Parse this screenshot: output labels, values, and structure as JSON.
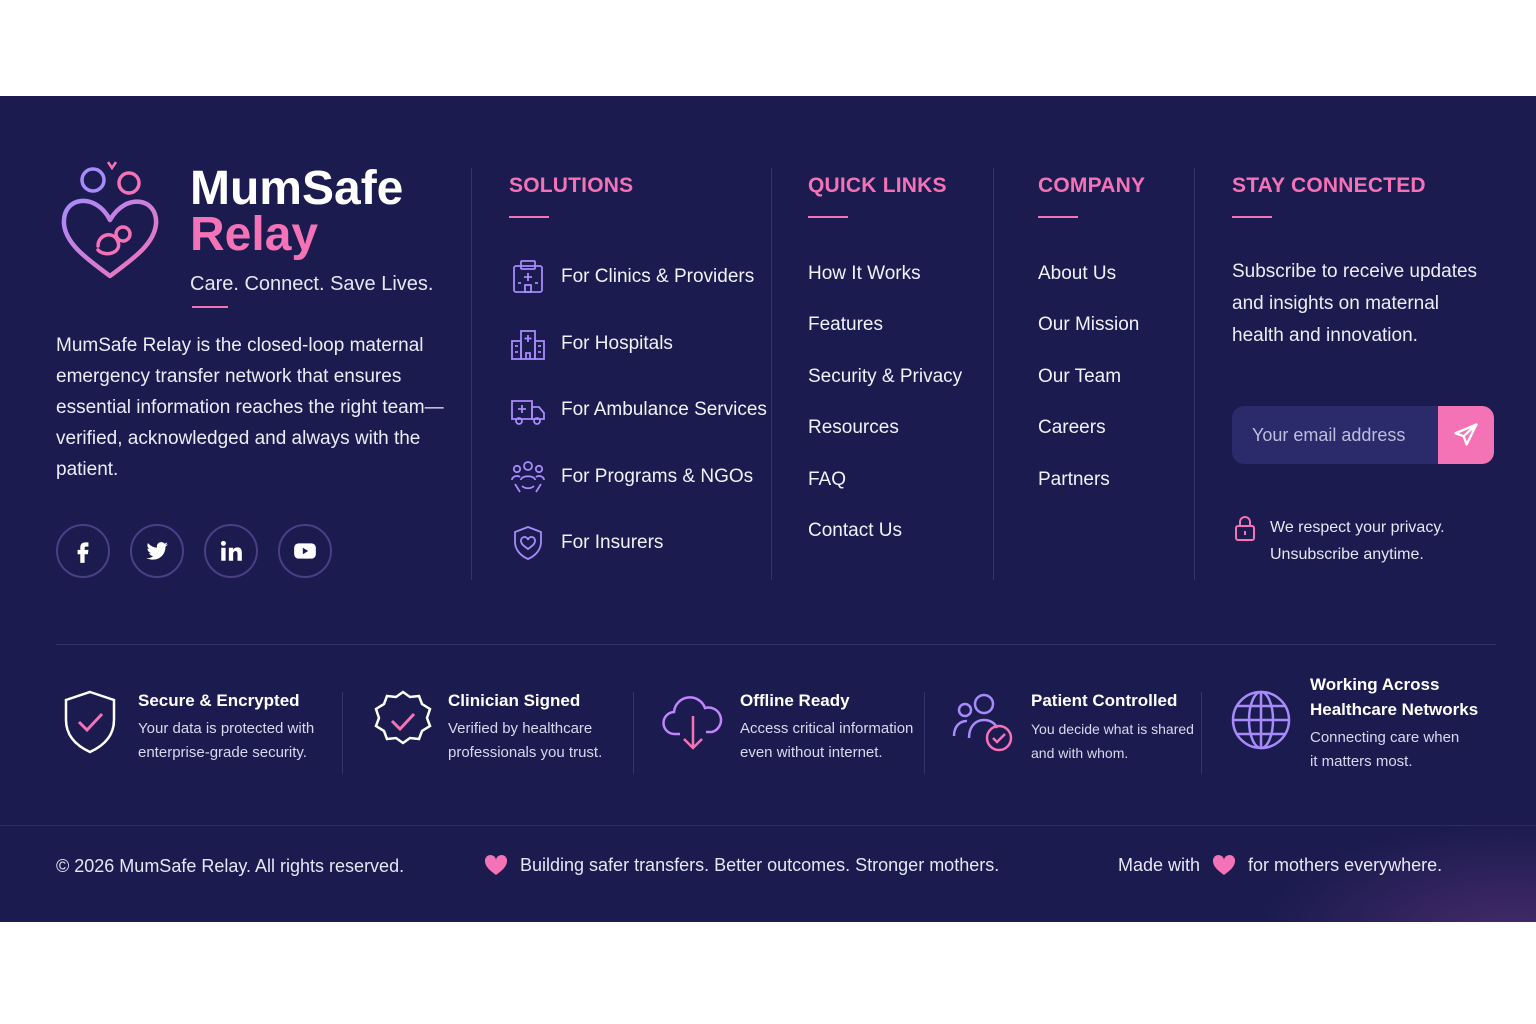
{
  "brand": {
    "name_line1": "MumSafe",
    "name_line2": "Relay",
    "tagline": "Care. Connect. Save Lives.",
    "description": "MumSafe Relay is the closed-loop maternal emergency transfer network that ensures essential information reaches the right team—verified, acknowledged and always with the patient."
  },
  "socials": [
    {
      "icon": "facebook-icon"
    },
    {
      "icon": "twitter-icon"
    },
    {
      "icon": "linkedin-icon"
    },
    {
      "icon": "youtube-icon"
    }
  ],
  "solutions": {
    "title": "SOLUTIONS",
    "items": [
      {
        "label": "For Clinics & Providers",
        "icon": "clinic-icon"
      },
      {
        "label": "For Hospitals",
        "icon": "hospital-icon"
      },
      {
        "label": "For Ambulance Services",
        "icon": "ambulance-icon"
      },
      {
        "label": "For Programs & NGOs",
        "icon": "community-icon"
      },
      {
        "label": "For Insurers",
        "icon": "shield-heart-icon"
      }
    ]
  },
  "quick_links": {
    "title": "QUICK LINKS",
    "items": [
      "How It Works",
      "Features",
      "Security & Privacy",
      "Resources",
      "FAQ",
      "Contact Us"
    ]
  },
  "company": {
    "title": "COMPANY",
    "items": [
      "About Us",
      "Our Mission",
      "Our Team",
      "Careers",
      "Partners"
    ]
  },
  "stay_connected": {
    "title": "STAY CONNECTED",
    "text": "Subscribe to receive updates and insights on maternal health and innovation.",
    "email_placeholder": "Your email address",
    "privacy_line1": "We respect your privacy.",
    "privacy_line2": "Unsubscribe anytime."
  },
  "features": [
    {
      "title": "Secure & Encrypted",
      "desc1": "Your data is protected with",
      "desc2": "enterprise-grade security.",
      "icon": "shield-check-icon"
    },
    {
      "title": "Clinician Signed",
      "desc1": "Verified by healthcare",
      "desc2": "professionals you trust.",
      "icon": "badge-check-icon"
    },
    {
      "title": "Offline Ready",
      "desc1": "Access critical information",
      "desc2": "even without internet.",
      "icon": "cloud-download-icon"
    },
    {
      "title": "Patient Controlled",
      "desc1": "You decide what is shared",
      "desc2": "and with whom.",
      "icon": "users-check-icon"
    },
    {
      "title1": "Working Across",
      "title2": "Healthcare Networks",
      "desc1": "Connecting care when",
      "desc2": "it matters most.",
      "icon": "globe-icon"
    }
  ],
  "bottom": {
    "copyright": "© 2026 MumSafe Relay. All rights reserved.",
    "motto": "Building safer transfers. Better outcomes. Stronger mothers.",
    "made_with": "Made with",
    "for_mothers": "for mothers everywhere."
  },
  "colors": {
    "background": "#1b1b4f",
    "accent_pink": "#f472b6",
    "accent_purple": "#a78bfa"
  }
}
